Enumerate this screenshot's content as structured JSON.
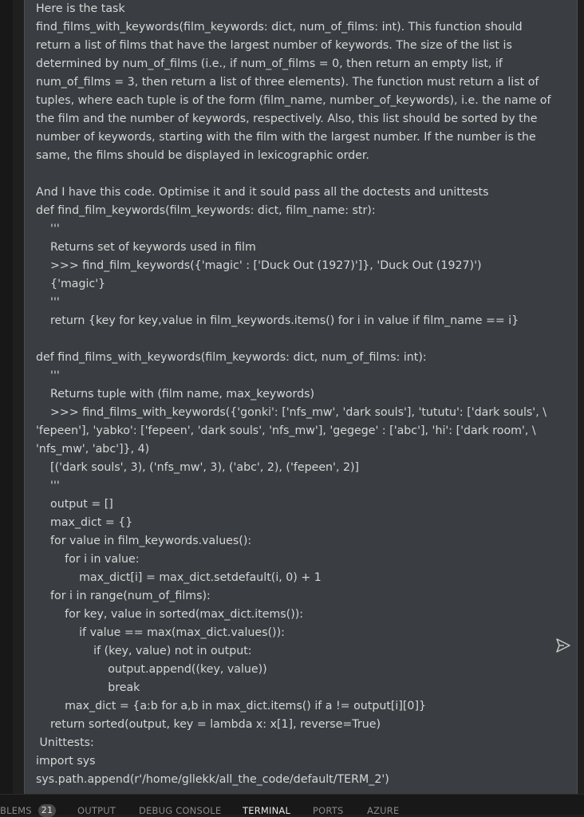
{
  "chat": {
    "lines": [
      "Here is the task",
      "find_films_with_keywords(film_keywords: dict, num_of_films: int). This function should",
      "return a list of films that have the largest number of keywords. The size of the list is",
      "determined by num_of_films (i.e., if num_of_films = 0, then return an empty list, if",
      "num_of_films = 3, then return a list of three elements). The function must return a list of",
      "tuples, where each tuple is of the form (film_name, number_of_keywords), i.e. the name of",
      "the film and the number of keywords, respectively. Also, this list should be sorted by the",
      "number of keywords, starting with the film with the largest number. If the number is the",
      "same, the films should be displayed in lexicographic order.",
      "",
      "And I have this code. Optimise it and it sould pass all the doctests and unittests",
      "def find_film_keywords(film_keywords: dict, film_name: str):",
      "    '''",
      "    Returns set of keywords used in film",
      "    >>> find_film_keywords({'magic' : ['Duck Out (1927)']}, 'Duck Out (1927)')",
      "    {'magic'}",
      "    '''",
      "    return {key for key,value in film_keywords.items() for i in value if film_name == i}",
      "",
      "def find_films_with_keywords(film_keywords: dict, num_of_films: int):",
      "    '''",
      "    Returns tuple with (film name, max_keywords)",
      "    >>> find_films_with_keywords({'gonki': ['nfs_mw', 'dark souls'], 'tututu': ['dark souls', \\",
      "'fepeen'], 'yabko': ['fepeen', 'dark souls', 'nfs_mw'], 'gegege' : ['abc'], 'hi': ['dark room', \\",
      "'nfs_mw', 'abc']}, 4)",
      "    [('dark souls', 3), ('nfs_mw', 3), ('abc', 2), ('fepeen', 2)]",
      "    '''",
      "    output = []",
      "    max_dict = {}",
      "    for value in film_keywords.values():",
      "        for i in value:",
      "            max_dict[i] = max_dict.setdefault(i, 0) + 1",
      "    for i in range(num_of_films):",
      "        for key, value in sorted(max_dict.items()):",
      "            if value == max(max_dict.values()):",
      "                if (key, value) not in output:",
      "                    output.append((key, value))",
      "                    break",
      "        max_dict = {a:b for a,b in max_dict.items() if a != output[i][0]}",
      "    return sorted(output, key = lambda x: x[1], reverse=True)",
      " Unittests:",
      "import sys",
      "sys.path.append(r'/home/gllekk/all_the_code/default/TERM_2')"
    ]
  },
  "panel": {
    "problems_label": "BLEMS",
    "problems_count": "21",
    "output_label": "OUTPUT",
    "debug_console_label": "DEBUG CONSOLE",
    "terminal_label": "TERMINAL",
    "ports_label": "PORTS",
    "azure_label": "AZURE"
  },
  "icons": {
    "send": "send-icon"
  },
  "colors": {
    "editor_bg": "#3a3d41",
    "text": "#d6d6d6",
    "panel_bg": "#181818"
  }
}
